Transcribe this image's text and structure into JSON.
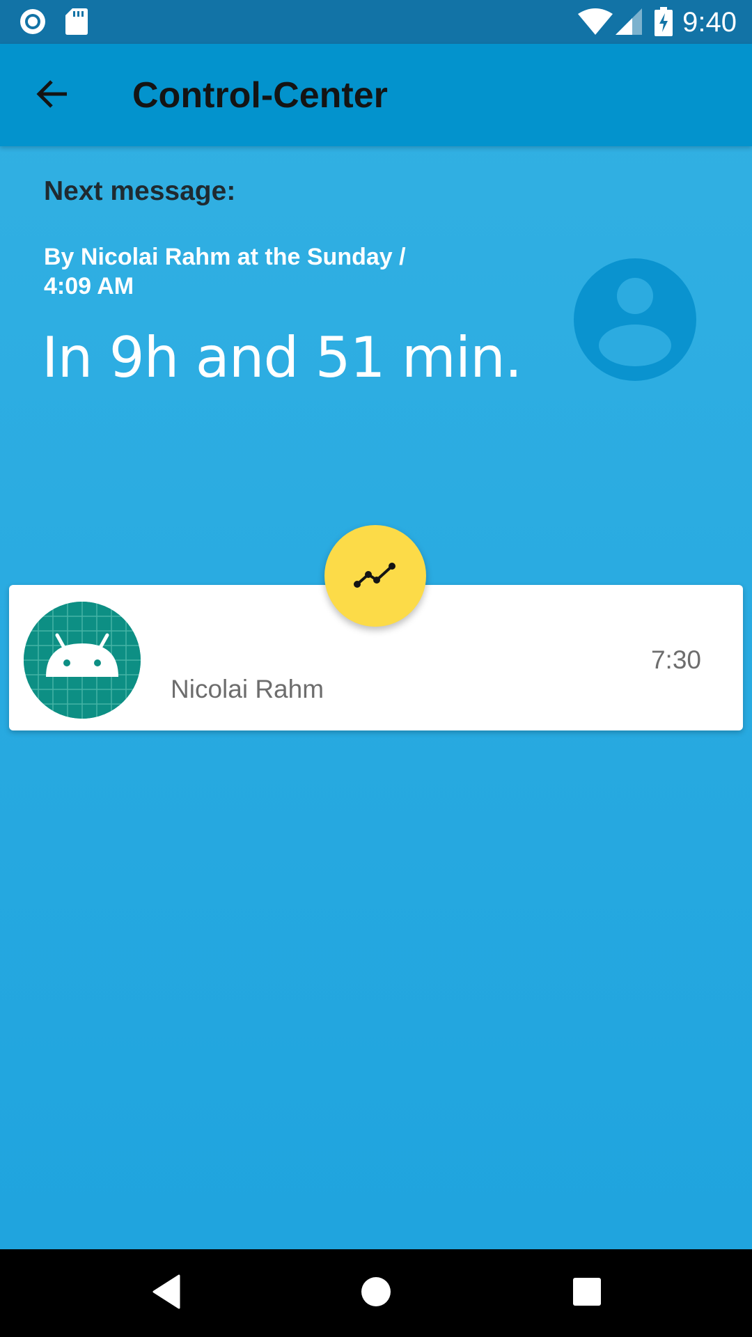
{
  "status_bar": {
    "time": "9:40",
    "icons": [
      "record-icon",
      "sd-card-icon",
      "wifi-icon",
      "cell-signal-icon",
      "battery-charging-icon"
    ]
  },
  "app_bar": {
    "title": "Control-Center",
    "back_icon": "arrow-back-icon"
  },
  "next_message": {
    "label": "Next message:",
    "by_line": "By Nicolai Rahm at the Sunday / 4:09 AM",
    "countdown": "In 9h and 51 min.",
    "avatar_icon": "person-icon"
  },
  "fab": {
    "icon": "chart-line-icon",
    "color": "#fcdb48"
  },
  "entries": [
    {
      "name": "Nicolai Rahm",
      "time": "7:30",
      "avatar_icon": "android-icon"
    }
  ],
  "nav_bar": {
    "icons": [
      "nav-back-icon",
      "nav-home-icon",
      "nav-recents-icon"
    ]
  },
  "colors": {
    "background": "#1ea3de",
    "app_bar": "#0393cd",
    "status_bar": "#1273a6",
    "accent": "#fcdb48",
    "card": "#ffffff"
  }
}
